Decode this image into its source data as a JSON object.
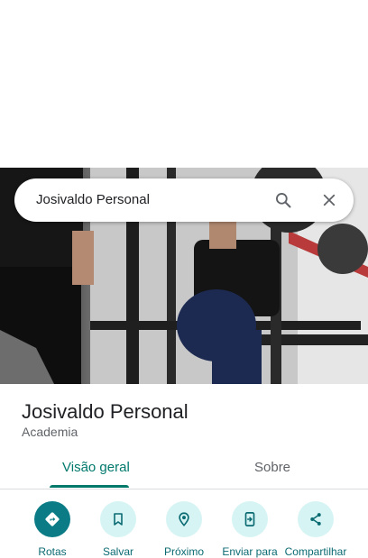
{
  "search": {
    "query": "Josivaldo Personal"
  },
  "place": {
    "name": "Josivaldo Personal",
    "category": "Academia"
  },
  "tabs": [
    {
      "label": "Visão geral",
      "active": true
    },
    {
      "label": "Sobre",
      "active": false
    }
  ],
  "actions": [
    {
      "label": "Rotas",
      "icon": "directions-icon"
    },
    {
      "label": "Salvar",
      "icon": "bookmark-icon"
    },
    {
      "label": "Próximo",
      "icon": "nearby-icon"
    },
    {
      "label": "Enviar para",
      "icon": "send-to-phone-icon"
    },
    {
      "label": "Compartilhar",
      "icon": "share-icon"
    }
  ],
  "colors": {
    "accent": "#00796b",
    "action_primary": "#0b7c86",
    "action_bg": "#d7f4f4"
  }
}
